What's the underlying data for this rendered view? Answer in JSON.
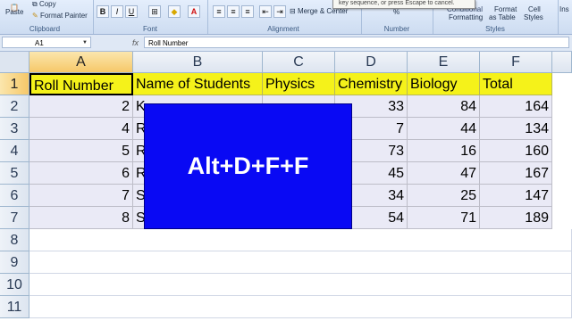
{
  "ribbon": {
    "clipboard": {
      "paste_label": "Paste",
      "copy_label": "Copy",
      "format_painter_label": "Format Painter",
      "group_label": "Clipboard"
    },
    "font": {
      "bold": "B",
      "italic": "I",
      "underline": "U",
      "group_label": "Font"
    },
    "alignment": {
      "merge_label": "Merge & Center",
      "group_label": "Alignment"
    },
    "number": {
      "group_label": "Number",
      "percent": "%"
    },
    "styles": {
      "conditional_label": "Conditional",
      "conditional_label2": "Formatting",
      "format_table_label": "Format",
      "format_table_label2": "as Table",
      "cell_styles_label": "Cell",
      "cell_styles_label2": "Styles",
      "group_label": "Styles"
    },
    "insert_label": "Ins",
    "tooltip_text": "key sequence, or press Escape to cancel."
  },
  "formula_bar": {
    "name_box": "A1",
    "fx": "fx",
    "content": "Roll Number"
  },
  "sheet": {
    "columns": [
      "A",
      "B",
      "C",
      "D",
      "E",
      "F"
    ],
    "rows": [
      "1",
      "2",
      "3",
      "4",
      "5",
      "6",
      "7",
      "8",
      "9",
      "10",
      "11"
    ],
    "header_row": [
      "Roll Number",
      "Name of Students",
      "Physics",
      "Chemistry",
      "Biology",
      "Total"
    ],
    "data_rows": [
      {
        "roll": "2",
        "name": "K",
        "physics": "",
        "chemistry": "33",
        "biology": "84",
        "total": "164"
      },
      {
        "roll": "4",
        "name": "R",
        "physics": "",
        "chemistry": "7",
        "biology": "44",
        "total": "134"
      },
      {
        "roll": "5",
        "name": "R",
        "physics": "",
        "chemistry": "73",
        "biology": "16",
        "total": "160"
      },
      {
        "roll": "6",
        "name": "R",
        "physics": "",
        "chemistry": "45",
        "biology": "47",
        "total": "167"
      },
      {
        "roll": "7",
        "name": "Sa",
        "physics": "",
        "chemistry": "34",
        "biology": "25",
        "total": "147"
      },
      {
        "roll": "8",
        "name": "S",
        "physics": "",
        "chemistry": "54",
        "biology": "71",
        "total": "189"
      }
    ]
  },
  "overlay": {
    "text": "Alt+D+F+F"
  },
  "colors": {
    "header_fill": "#f5f21a",
    "data_fill": "#eaeaf6",
    "overlay_fill": "#0909f4"
  }
}
